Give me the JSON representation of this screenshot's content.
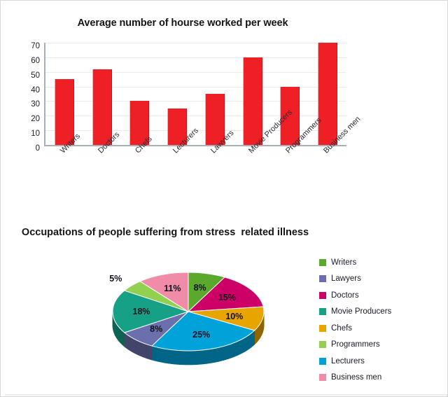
{
  "chart_data": [
    {
      "type": "bar",
      "title": "Average number of hourse worked per week",
      "xlabel": "",
      "ylabel": "",
      "categories": [
        "Writers",
        "Doctors",
        "Chefs",
        "Lecturers",
        "Lawyers",
        "Movie Producers",
        "Programmers",
        "Business men"
      ],
      "values": [
        45,
        52,
        30,
        25,
        35,
        60,
        40,
        70
      ],
      "ylim": [
        0,
        70
      ],
      "yticks": [
        70,
        60,
        50,
        40,
        30,
        20,
        10,
        0
      ],
      "grid": true,
      "legend": "none",
      "series_color": "#ee2026"
    },
    {
      "type": "pie",
      "title": "Occupations of people suffering from stress  related illness",
      "legend_position": "right",
      "labels": [
        "Writers",
        "Lawyers",
        "Doctors",
        "Movie Producers",
        "Chefs",
        "Programmers",
        "Lecturers",
        "Business men"
      ],
      "colors": [
        "#5aa82c",
        "#6b6fad",
        "#cc0066",
        "#16a085",
        "#e8a400",
        "#92d050",
        "#00a3d9",
        "#f08ba8"
      ],
      "slices": [
        {
          "label": "Writers",
          "value": 8,
          "display": "8%",
          "color": "#5aa82c"
        },
        {
          "label": "Doctors",
          "value": 15,
          "display": "15%",
          "color": "#cc0066"
        },
        {
          "label": "Chefs",
          "value": 10,
          "display": "10%",
          "color": "#e8a400"
        },
        {
          "label": "Lecturers",
          "value": 25,
          "display": "25%",
          "color": "#00a3d9"
        },
        {
          "label": "Lawyers",
          "value": 8,
          "display": "8%",
          "color": "#6b6fad"
        },
        {
          "label": "Movie Producers",
          "value": 18,
          "display": "18%",
          "color": "#16a085"
        },
        {
          "label": "Programmers",
          "value": 5,
          "display": "5%",
          "color": "#92d050"
        },
        {
          "label": "Business men",
          "value": 11,
          "display": "11%",
          "color": "#f08ba8"
        }
      ]
    }
  ],
  "bar_chart": {
    "title": "Average number of hourse worked per week",
    "y_ticks": [
      "70",
      "60",
      "50",
      "40",
      "30",
      "20",
      "10",
      "0"
    ],
    "bars": [
      {
        "label": "Writers",
        "value": 45
      },
      {
        "label": "Doctors",
        "value": 52
      },
      {
        "label": "Chefs",
        "value": 30
      },
      {
        "label": "Lecturers",
        "value": 25
      },
      {
        "label": "Lawyers",
        "value": 35
      },
      {
        "label": "Movie Producers",
        "value": 60
      },
      {
        "label": "Programmers",
        "value": 40
      },
      {
        "label": "Business men",
        "value": 70
      }
    ]
  },
  "pie_chart": {
    "title": "Occupations of people suffering from stress  related illness",
    "percent_labels": [
      "8%",
      "15%",
      "10%",
      "25%",
      "8%",
      "18%",
      "5%",
      "11%"
    ],
    "legend": [
      {
        "label": "Writers",
        "color": "#5aa82c"
      },
      {
        "label": "Lawyers",
        "color": "#6b6fad"
      },
      {
        "label": "Doctors",
        "color": "#cc0066"
      },
      {
        "label": "Movie Producers",
        "color": "#16a085"
      },
      {
        "label": "Chefs",
        "color": "#e8a400"
      },
      {
        "label": "Programmers",
        "color": "#92d050"
      },
      {
        "label": "Lecturers",
        "color": "#00a3d9"
      },
      {
        "label": "Business men",
        "color": "#f08ba8"
      }
    ]
  }
}
